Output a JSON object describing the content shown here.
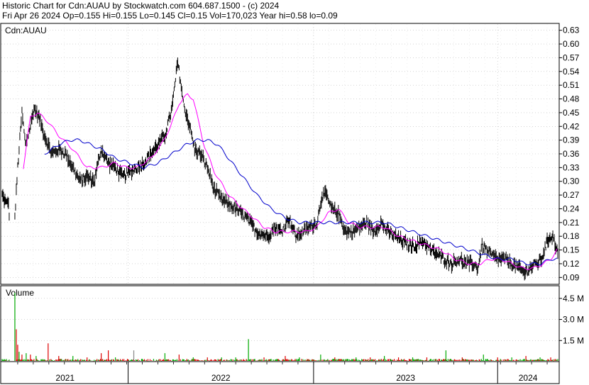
{
  "header": {
    "line1": "Historic Chart for Cdn:AUAU by Stockwatch.com 604.687.1500 - (c) 2024",
    "line2": "Fri Apr 26 2024   Op=0.155  Hi=0.155  Lo=0.145  Cl=0.15  Vol=170,023  Year hi=0.58  lo=0.09"
  },
  "price_panel": {
    "label": "Cdn:AUAU",
    "y_ticks": [
      "0.63",
      "0.60",
      "0.57",
      "0.54",
      "0.51",
      "0.48",
      "0.45",
      "0.42",
      "0.39",
      "0.36",
      "0.33",
      "0.30",
      "0.27",
      "0.24",
      "0.21",
      "0.18",
      "0.15",
      "0.12",
      "0.09"
    ]
  },
  "volume_panel": {
    "label": "Volume",
    "y_ticks": [
      "4.5 M",
      "3.0 M",
      "1.5 M"
    ]
  },
  "x_axis": {
    "years": [
      "2021",
      "2022",
      "2023",
      "2024"
    ]
  },
  "colors": {
    "price": "#000000",
    "ma_short": "#ff00ff",
    "ma_long": "#0000cc",
    "vol_up": "#00aa00",
    "vol_down": "#dd0000",
    "vol_flat": "#888888",
    "grid": "#bbbbbb"
  },
  "chart_data": [
    {
      "type": "line",
      "title": "Cdn:AUAU",
      "x_unit": "trading days (approx. Feb 2021 – Apr 2024)",
      "ylim": [
        0.075,
        0.645
      ],
      "y_ticks": [
        0.63,
        0.6,
        0.57,
        0.54,
        0.51,
        0.48,
        0.45,
        0.42,
        0.39,
        0.36,
        0.33,
        0.3,
        0.27,
        0.24,
        0.21,
        0.18,
        0.15,
        0.12,
        0.09
      ],
      "year_labels": [
        "2021",
        "2022",
        "2023",
        "2024"
      ],
      "price_anchors": [
        [
          0,
          0.27
        ],
        [
          6,
          0.25
        ],
        [
          8,
          0.26
        ],
        [
          10,
          0.23
        ],
        [
          14,
          0.28
        ],
        [
          18,
          0.22
        ],
        [
          22,
          0.33
        ],
        [
          28,
          0.45
        ],
        [
          33,
          0.38
        ],
        [
          40,
          0.42
        ],
        [
          45,
          0.46
        ],
        [
          52,
          0.44
        ],
        [
          60,
          0.4
        ],
        [
          70,
          0.36
        ],
        [
          80,
          0.37
        ],
        [
          90,
          0.36
        ],
        [
          100,
          0.33
        ],
        [
          110,
          0.3
        ],
        [
          120,
          0.31
        ],
        [
          130,
          0.3
        ],
        [
          140,
          0.37
        ],
        [
          150,
          0.34
        ],
        [
          160,
          0.33
        ],
        [
          170,
          0.31
        ],
        [
          180,
          0.32
        ],
        [
          190,
          0.33
        ],
        [
          200,
          0.34
        ],
        [
          210,
          0.36
        ],
        [
          220,
          0.38
        ],
        [
          230,
          0.4
        ],
        [
          240,
          0.46
        ],
        [
          248,
          0.56
        ],
        [
          252,
          0.52
        ],
        [
          256,
          0.47
        ],
        [
          265,
          0.42
        ],
        [
          272,
          0.37
        ],
        [
          280,
          0.36
        ],
        [
          290,
          0.33
        ],
        [
          300,
          0.28
        ],
        [
          310,
          0.26
        ],
        [
          320,
          0.25
        ],
        [
          330,
          0.24
        ],
        [
          345,
          0.22
        ],
        [
          360,
          0.19
        ],
        [
          375,
          0.18
        ],
        [
          385,
          0.2
        ],
        [
          395,
          0.19
        ],
        [
          405,
          0.22
        ],
        [
          415,
          0.18
        ],
        [
          425,
          0.19
        ],
        [
          435,
          0.2
        ],
        [
          445,
          0.21
        ],
        [
          452,
          0.27
        ],
        [
          458,
          0.27
        ],
        [
          465,
          0.24
        ],
        [
          475,
          0.23
        ],
        [
          485,
          0.19
        ],
        [
          495,
          0.19
        ],
        [
          505,
          0.2
        ],
        [
          515,
          0.21
        ],
        [
          525,
          0.19
        ],
        [
          535,
          0.21
        ],
        [
          545,
          0.19
        ],
        [
          555,
          0.18
        ],
        [
          565,
          0.17
        ],
        [
          575,
          0.16
        ],
        [
          585,
          0.16
        ],
        [
          595,
          0.17
        ],
        [
          605,
          0.15
        ],
        [
          615,
          0.14
        ],
        [
          625,
          0.13
        ],
        [
          635,
          0.12
        ],
        [
          645,
          0.13
        ],
        [
          655,
          0.12
        ],
        [
          665,
          0.12
        ],
        [
          672,
          0.11
        ],
        [
          678,
          0.16
        ],
        [
          684,
          0.15
        ],
        [
          690,
          0.14
        ],
        [
          700,
          0.13
        ],
        [
          710,
          0.13
        ],
        [
          720,
          0.12
        ],
        [
          730,
          0.11
        ],
        [
          738,
          0.1
        ],
        [
          745,
          0.11
        ],
        [
          755,
          0.12
        ],
        [
          762,
          0.13
        ],
        [
          768,
          0.16
        ],
        [
          774,
          0.18
        ],
        [
          778,
          0.18
        ],
        [
          782,
          0.16
        ],
        [
          784,
          0.15
        ]
      ],
      "ma_short_anchors": [
        [
          30,
          0.33
        ],
        [
          40,
          0.44
        ],
        [
          50,
          0.45
        ],
        [
          65,
          0.43
        ],
        [
          80,
          0.4
        ],
        [
          100,
          0.37
        ],
        [
          120,
          0.33
        ],
        [
          140,
          0.33
        ],
        [
          160,
          0.34
        ],
        [
          175,
          0.33
        ],
        [
          190,
          0.33
        ],
        [
          210,
          0.35
        ],
        [
          225,
          0.38
        ],
        [
          238,
          0.42
        ],
        [
          250,
          0.47
        ],
        [
          262,
          0.49
        ],
        [
          270,
          0.48
        ],
        [
          285,
          0.38
        ],
        [
          300,
          0.32
        ],
        [
          320,
          0.27
        ],
        [
          340,
          0.24
        ],
        [
          355,
          0.22
        ],
        [
          370,
          0.2
        ],
        [
          385,
          0.19
        ],
        [
          400,
          0.19
        ],
        [
          415,
          0.19
        ],
        [
          430,
          0.19
        ],
        [
          445,
          0.2
        ],
        [
          460,
          0.23
        ],
        [
          475,
          0.24
        ],
        [
          490,
          0.21
        ],
        [
          505,
          0.2
        ],
        [
          520,
          0.2
        ],
        [
          540,
          0.2
        ],
        [
          560,
          0.18
        ],
        [
          580,
          0.17
        ],
        [
          600,
          0.16
        ],
        [
          620,
          0.15
        ],
        [
          640,
          0.13
        ],
        [
          660,
          0.12
        ],
        [
          675,
          0.12
        ],
        [
          690,
          0.13
        ],
        [
          705,
          0.13
        ],
        [
          720,
          0.12
        ],
        [
          735,
          0.11
        ],
        [
          750,
          0.11
        ],
        [
          765,
          0.12
        ],
        [
          775,
          0.13
        ],
        [
          784,
          0.15
        ]
      ],
      "ma_long_anchors": [
        [
          60,
          0.36
        ],
        [
          80,
          0.38
        ],
        [
          95,
          0.39
        ],
        [
          110,
          0.39
        ],
        [
          125,
          0.38
        ],
        [
          140,
          0.37
        ],
        [
          160,
          0.35
        ],
        [
          180,
          0.34
        ],
        [
          200,
          0.33
        ],
        [
          220,
          0.34
        ],
        [
          240,
          0.36
        ],
        [
          260,
          0.38
        ],
        [
          275,
          0.39
        ],
        [
          290,
          0.39
        ],
        [
          305,
          0.38
        ],
        [
          320,
          0.35
        ],
        [
          340,
          0.31
        ],
        [
          360,
          0.27
        ],
        [
          380,
          0.24
        ],
        [
          400,
          0.22
        ],
        [
          420,
          0.21
        ],
        [
          440,
          0.21
        ],
        [
          460,
          0.21
        ],
        [
          480,
          0.21
        ],
        [
          500,
          0.21
        ],
        [
          520,
          0.21
        ],
        [
          540,
          0.21
        ],
        [
          560,
          0.2
        ],
        [
          580,
          0.19
        ],
        [
          600,
          0.18
        ],
        [
          620,
          0.17
        ],
        [
          640,
          0.16
        ],
        [
          660,
          0.15
        ],
        [
          680,
          0.14
        ],
        [
          700,
          0.13
        ],
        [
          720,
          0.13
        ],
        [
          740,
          0.12
        ],
        [
          760,
          0.12
        ],
        [
          775,
          0.13
        ],
        [
          784,
          0.13
        ]
      ]
    },
    {
      "type": "bar",
      "title": "Volume",
      "y_unit": "shares (millions)",
      "ylim": [
        0,
        5.4
      ],
      "y_ticks": [
        4.5,
        3.0,
        1.5
      ],
      "baseline": 0.12,
      "spikes": [
        [
          18,
          4.9,
          "up"
        ],
        [
          20,
          2.3,
          "down"
        ],
        [
          22,
          1.2,
          "down"
        ],
        [
          24,
          0.7,
          "up"
        ],
        [
          28,
          0.5,
          "down"
        ],
        [
          34,
          0.6,
          "up"
        ],
        [
          40,
          0.5,
          "down"
        ],
        [
          48,
          0.4,
          "up"
        ],
        [
          65,
          1.3,
          "down"
        ],
        [
          80,
          0.4,
          "down"
        ],
        [
          100,
          0.4,
          "up"
        ],
        [
          120,
          0.3,
          "down"
        ],
        [
          140,
          0.6,
          "down"
        ],
        [
          150,
          0.8,
          "down"
        ],
        [
          160,
          0.3,
          "up"
        ],
        [
          186,
          0.8,
          "flat"
        ],
        [
          230,
          0.6,
          "up"
        ],
        [
          250,
          0.5,
          "down"
        ],
        [
          270,
          0.3,
          "up"
        ],
        [
          290,
          0.3,
          "down"
        ],
        [
          310,
          0.3,
          "up"
        ],
        [
          330,
          0.3,
          "up"
        ],
        [
          348,
          1.6,
          "up"
        ],
        [
          370,
          0.3,
          "down"
        ],
        [
          400,
          0.4,
          "down"
        ],
        [
          420,
          0.3,
          "up"
        ],
        [
          450,
          0.5,
          "up"
        ],
        [
          470,
          0.3,
          "down"
        ],
        [
          500,
          0.3,
          "up"
        ],
        [
          520,
          0.3,
          "down"
        ],
        [
          540,
          0.4,
          "up"
        ],
        [
          560,
          0.3,
          "down"
        ],
        [
          580,
          0.3,
          "up"
        ],
        [
          600,
          0.3,
          "down"
        ],
        [
          627,
          0.8,
          "up"
        ],
        [
          650,
          0.3,
          "down"
        ],
        [
          680,
          0.5,
          "up"
        ],
        [
          700,
          0.3,
          "down"
        ],
        [
          720,
          0.3,
          "up"
        ],
        [
          740,
          0.4,
          "down"
        ],
        [
          760,
          0.3,
          "up"
        ],
        [
          775,
          0.3,
          "down"
        ]
      ]
    }
  ]
}
